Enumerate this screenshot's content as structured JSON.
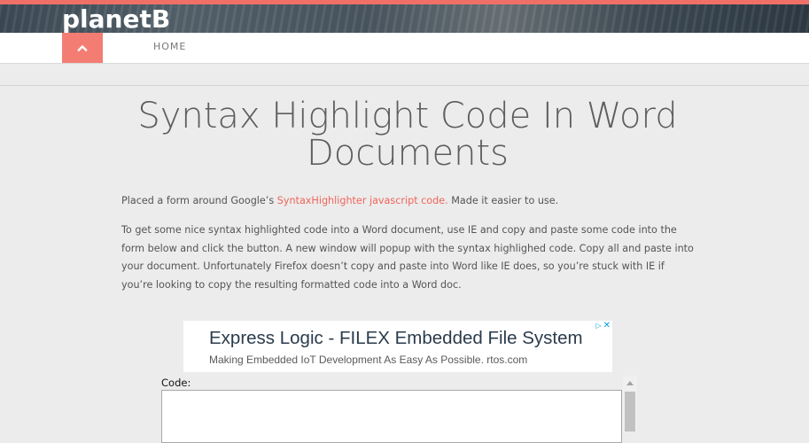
{
  "header": {
    "logo": "planetB",
    "accent_color": "#f07068",
    "nav": {
      "home_label": "HOME",
      "up_button_icon": "chevron-up-icon"
    }
  },
  "article": {
    "title": "Syntax Highlight Code In Word Documents",
    "para1": {
      "before": "Placed a form around Google’s ",
      "link": "SyntaxHighlighter javascript code.",
      "after": " Made it easier to use."
    },
    "para2": "To get some nice syntax highlighted code into a Word document, use IE and copy and paste some code into the form below and click the button. A new window will popup with the syntax highlighed code. Copy all and paste into your document. Unfortunately Firefox doesn’t copy and paste into Word like IE does, so you’re stuck with IE if you’re looking to copy the resulting formatted code into a Word doc."
  },
  "ad": {
    "title": "Express Logic - FILEX Embedded File System",
    "subtitle": "Making Embedded IoT Development As Easy As Possible. rtos.com",
    "choices_icon": "ad-choices-icon",
    "close_icon": "close-icon"
  },
  "form": {
    "code_label": "Code:",
    "code_value": ""
  },
  "colors": {
    "link": "#f0645a",
    "up_button": "#f47d73",
    "background": "#ececec"
  }
}
